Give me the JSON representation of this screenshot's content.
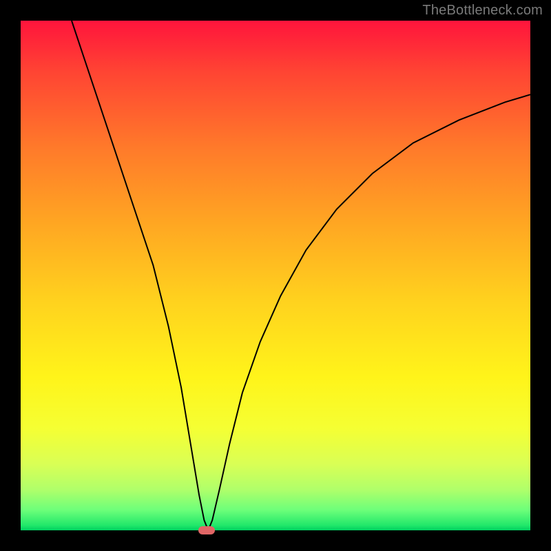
{
  "watermark": {
    "text": "TheBottleneck.com"
  },
  "chart_data": {
    "type": "line",
    "title": "",
    "xlabel": "",
    "ylabel": "",
    "xlim": [
      0,
      100
    ],
    "ylim": [
      0,
      100
    ],
    "grid": false,
    "curve": {
      "stroke": "#000000",
      "width": 2,
      "points": [
        [
          10,
          100
        ],
        [
          14,
          88
        ],
        [
          18,
          76
        ],
        [
          22,
          64
        ],
        [
          26,
          52
        ],
        [
          29,
          40
        ],
        [
          31.5,
          28
        ],
        [
          33.5,
          16
        ],
        [
          35,
          7
        ],
        [
          36,
          2
        ],
        [
          36.8,
          0
        ],
        [
          37.6,
          2
        ],
        [
          39,
          8
        ],
        [
          41,
          17
        ],
        [
          43.5,
          27
        ],
        [
          47,
          37
        ],
        [
          51,
          46
        ],
        [
          56,
          55
        ],
        [
          62,
          63
        ],
        [
          69,
          70
        ],
        [
          77,
          76
        ],
        [
          86,
          80.5
        ],
        [
          95,
          84
        ],
        [
          100,
          85.5
        ]
      ]
    },
    "minimum_marker": {
      "x": 36.5,
      "y": 0,
      "color": "#e06666"
    },
    "background_gradient": {
      "top": "#ff143c",
      "bottom": "#00d060"
    }
  }
}
